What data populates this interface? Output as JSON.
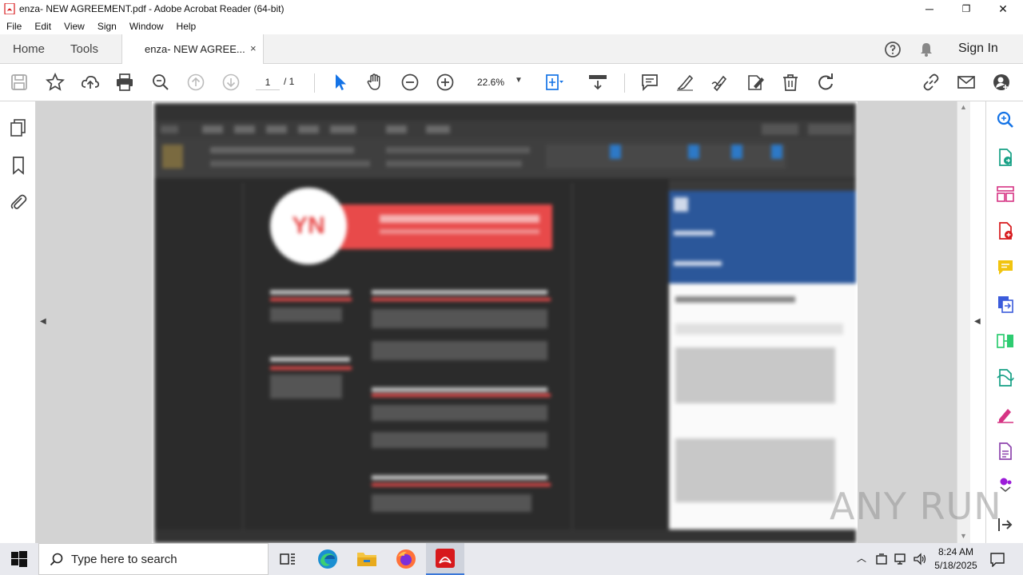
{
  "window": {
    "title": "enza- NEW AGREEMENT.pdf - Adobe Acrobat Reader (64-bit)",
    "minimize": "─",
    "maximize": "❐",
    "close": "✕"
  },
  "menu": [
    "File",
    "Edit",
    "View",
    "Sign",
    "Window",
    "Help"
  ],
  "tabs": {
    "home": "Home",
    "tools": "Tools",
    "document": "enza- NEW AGREE...",
    "close": "×",
    "sign_in": "Sign In"
  },
  "toolbar": {
    "page_current": "1",
    "page_total": "/ 1",
    "zoom": "22.6%"
  },
  "document_preview": {
    "initials": "YN",
    "name_banner": "MICROSOFT OFFICE USER",
    "sections": [
      "OBJECTIVE",
      "EXPERIENCE",
      "SKILLS",
      "EDUCATION",
      "VOLUNTEER EXPERIENCE OR LEADERSHIP"
    ],
    "side_panel_title": "Resume Assistant"
  },
  "watermark": "ANY RUN",
  "taskbar": {
    "search_placeholder": "Type here to search",
    "time": "8:24 AM",
    "date": "5/18/2025"
  },
  "colors": {
    "accent_blue": "#1473e6",
    "acrobat_red": "#d7191c",
    "resume_red": "#e84a4a",
    "word_blue": "#2b579a"
  }
}
